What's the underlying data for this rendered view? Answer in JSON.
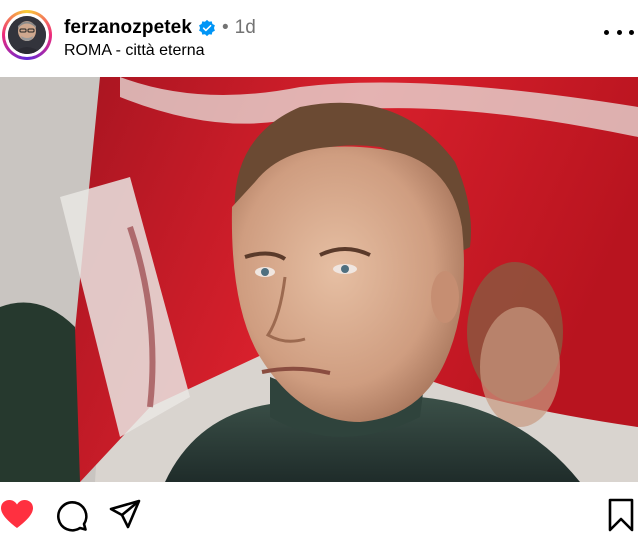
{
  "post": {
    "username": "ferzanozpetek",
    "verified": true,
    "separator": "•",
    "time": "1d",
    "location": "ROMA - città eterna"
  },
  "icons": {
    "verified": "verified-badge-icon",
    "more": "more-options-icon",
    "like": "heart-icon",
    "comment": "comment-icon",
    "share": "share-icon",
    "save": "bookmark-icon"
  },
  "state": {
    "liked": true
  },
  "colors": {
    "like_red": "#ff3040",
    "verified_blue": "#0095f6",
    "muted": "#737373"
  }
}
